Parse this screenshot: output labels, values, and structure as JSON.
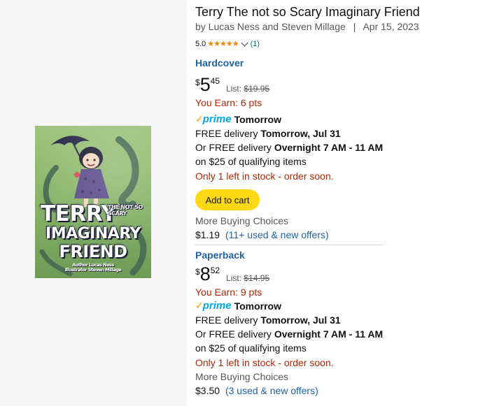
{
  "book": {
    "title": "Terry The not so Scary Imaginary Friend",
    "byline": "by Lucas Ness and Steven Millage",
    "separator": "|",
    "date": "Apr 15, 2023",
    "rating": "5.0",
    "rating_stars": "★★★★★",
    "rating_count": "(1)"
  },
  "cover": {
    "title_word1": "TERRY",
    "title_notso": "THE NOT SO SCARY",
    "title_word2": "IMAGINARY",
    "title_word3": "FRIEND",
    "author_line": "Author Lucas Ness",
    "illustrator_line": "Illustrator Steven Millage"
  },
  "hardcover": {
    "format": "Hardcover",
    "price_symbol": "$",
    "price_whole": "5",
    "price_fraction": "45",
    "list_label": "List: ",
    "list_price": "$19.95",
    "earn": "You Earn: 6 pts",
    "prime_check": "✓",
    "prime_word": "prime",
    "prime_day": "Tomorrow",
    "delivery_prefix": "FREE delivery ",
    "delivery_date": "Tomorrow, Jul 31",
    "or_prefix": "Or FREE delivery ",
    "overnight": "Overnight 7 AM - 11 AM",
    "qualifying": "on $25 of qualifying items",
    "stock": "Only 1 left in stock - order soon.",
    "add_to_cart": "Add to cart",
    "more_choices": "More Buying Choices",
    "used_price": "$1.19",
    "offers_link": "(11+ used & new offers)"
  },
  "paperback": {
    "format": "Paperback",
    "price_symbol": "$",
    "price_whole": "8",
    "price_fraction": "52",
    "list_label": "List: ",
    "list_price": "$14.95",
    "earn": "You Earn: 9 pts",
    "prime_check": "✓",
    "prime_word": "prime",
    "prime_day": "Tomorrow",
    "delivery_prefix": "FREE delivery ",
    "delivery_date": "Tomorrow, Jul 31",
    "or_prefix": "Or FREE delivery ",
    "overnight": "Overnight 7 AM - 11 AM",
    "qualifying": "on $25 of qualifying items",
    "stock": "Only 1 left in stock - order soon.",
    "more_choices": "More Buying Choices",
    "used_price": "$3.50",
    "offers_link": "(3 used & new offers)"
  },
  "colors": {
    "link": "#2162a1",
    "deal_red": "#b12704",
    "prime_blue": "#00a8e1",
    "star_orange": "#f08804",
    "cart_yellow": "#ffd814"
  }
}
